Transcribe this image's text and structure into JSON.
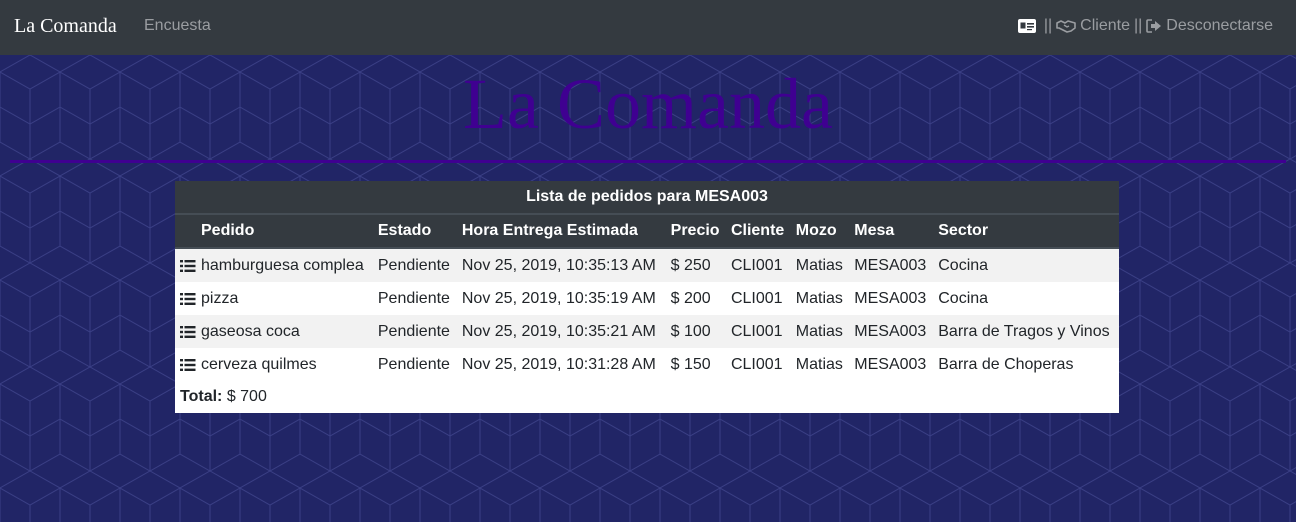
{
  "navbar": {
    "brand": "La Comanda",
    "link_encuesta": "Encuesta",
    "sep1": "||",
    "cliente": "Cliente",
    "sep2": "||",
    "logout": "Desconectarse"
  },
  "header": {
    "title": "La Comanda"
  },
  "table": {
    "caption": "Lista de pedidos para MESA003",
    "columns": [
      "Pedido",
      "Estado",
      "Hora Entrega Estimada",
      "Precio",
      "Cliente",
      "Mozo",
      "Mesa",
      "Sector"
    ],
    "rows": [
      [
        "hamburguesa complea",
        "Pendiente",
        "Nov 25, 2019, 10:35:13 AM",
        "$ 250",
        "CLI001",
        "Matias",
        "MESA003",
        "Cocina"
      ],
      [
        "pizza",
        "Pendiente",
        "Nov 25, 2019, 10:35:19 AM",
        "$ 200",
        "CLI001",
        "Matias",
        "MESA003",
        "Cocina"
      ],
      [
        "gaseosa coca",
        "Pendiente",
        "Nov 25, 2019, 10:35:21 AM",
        "$ 100",
        "CLI001",
        "Matias",
        "MESA003",
        "Barra de Tragos y Vinos"
      ],
      [
        "cerveza quilmes",
        "Pendiente",
        "Nov 25, 2019, 10:31:28 AM",
        "$ 150",
        "CLI001",
        "Matias",
        "MESA003",
        "Barra de Choperas"
      ]
    ],
    "total_label": "Total:",
    "total_value": "$ 700"
  },
  "icons": {
    "row_icon": "list-icon",
    "id_card": "id-card-icon",
    "handshake": "handshake-icon",
    "logout": "sign-out-icon"
  },
  "colors": {
    "background": "#212566",
    "navbar": "#343a40",
    "title": "#3f0091"
  }
}
